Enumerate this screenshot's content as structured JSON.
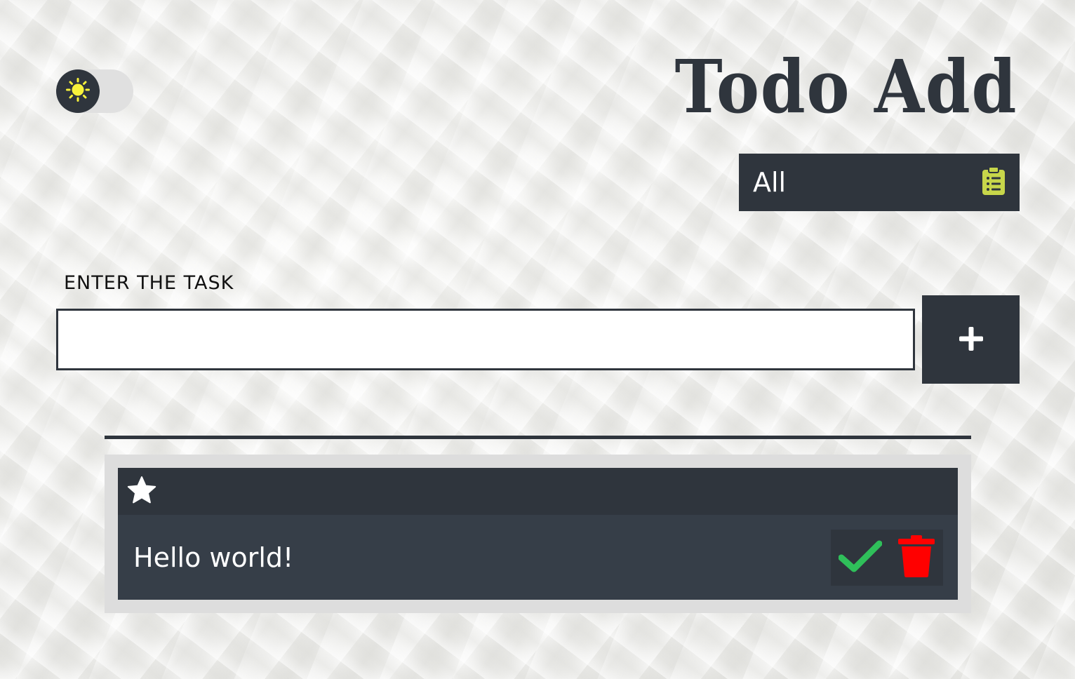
{
  "app": {
    "title": "Todo Add"
  },
  "theme_toggle": {
    "icon": "sun-icon",
    "mode": "light"
  },
  "filter": {
    "selected": "All",
    "icon": "clipboard-list-icon"
  },
  "task_form": {
    "label": "ENTER THE TASK",
    "value": "",
    "placeholder": "",
    "add_icon": "plus-icon"
  },
  "todos": [
    {
      "text": "Hello world!",
      "starred": true,
      "star_icon": "star-icon",
      "complete_icon": "check-icon",
      "delete_icon": "trash-icon"
    }
  ],
  "colors": {
    "dark": "#2f353d",
    "card_body": "#363e48",
    "sun": "#f7f23b",
    "clipboard": "#c7d64a",
    "check": "#2fbf5a",
    "trash": "#ff0000"
  }
}
